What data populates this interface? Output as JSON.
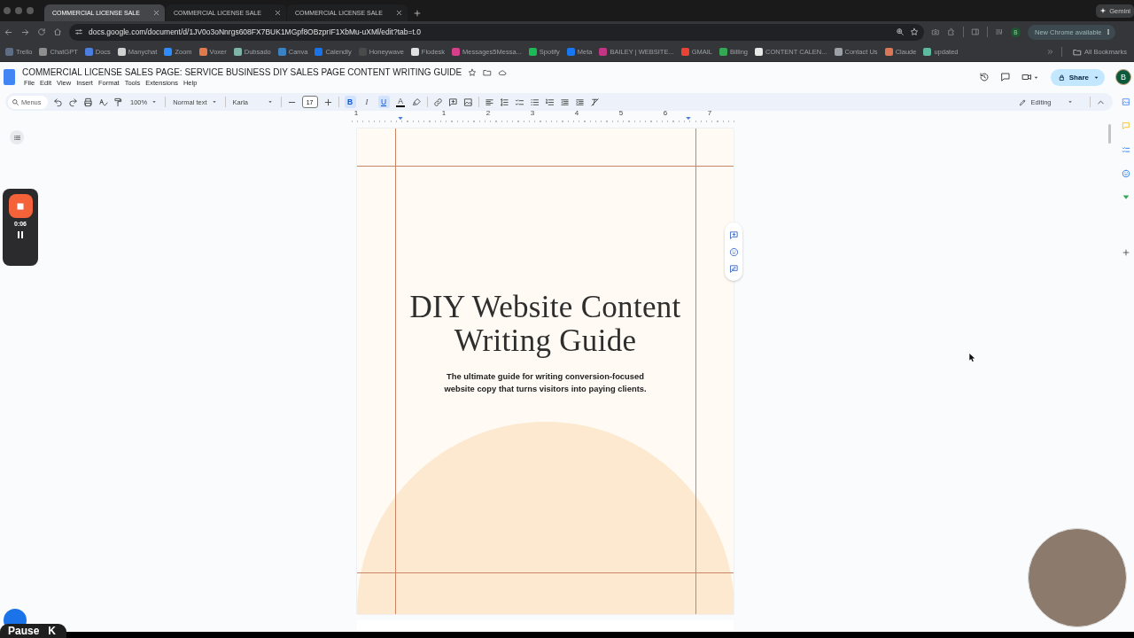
{
  "browser": {
    "tabs": [
      {
        "title": "COMMERCIAL LICENSE SALE",
        "selected": true
      },
      {
        "title": "COMMERCIAL LICENSE SALE",
        "selected": false
      },
      {
        "title": "COMMERCIAL LICENSE SALE",
        "selected": false
      }
    ],
    "gemini_button": "Gemini",
    "address": "docs.google.com/document/d/1JV0o3oNnrgs608FX7BUK1MGpf8OBzprIF1XbMu-uXMl/edit?tab=t.0",
    "profile_initial": "B",
    "update_button": "New Chrome available",
    "bookmarks": [
      {
        "label": "Trello",
        "color": "#5e6c84"
      },
      {
        "label": "ChatGPT",
        "color": "#8e8e8e"
      },
      {
        "label": "Docs",
        "color": "#4a7fe0"
      },
      {
        "label": "Manychat",
        "color": "#d0d0d0"
      },
      {
        "label": "Zoom",
        "color": "#2d8cff"
      },
      {
        "label": "Voxer",
        "color": "#e07a4a"
      },
      {
        "label": "Dubsado",
        "color": "#7fb5a8"
      },
      {
        "label": "Canva",
        "color": "#3b82c4"
      },
      {
        "label": "Calendly",
        "color": "#1a73e8"
      },
      {
        "label": "Honeywave",
        "color": "#4a4a4a"
      },
      {
        "label": "Flodesk",
        "color": "#e0e0e0"
      },
      {
        "label": "Messages5Messa...",
        "color": "#d6408a"
      },
      {
        "label": "Spotify",
        "color": "#1db954"
      },
      {
        "label": "Meta",
        "color": "#1877f2"
      },
      {
        "label": "BAILEY | WEBSITE...",
        "color": "#c13584"
      },
      {
        "label": "GMAIL",
        "color": "#ea4335"
      },
      {
        "label": "Billing",
        "color": "#34a853"
      },
      {
        "label": "CONTENT CALEN...",
        "color": "#e8e8e8"
      },
      {
        "label": "Contact Us",
        "color": "#9aa0a6"
      },
      {
        "label": "Claude",
        "color": "#d97757"
      },
      {
        "label": "updated",
        "color": "#5fb8a0"
      }
    ],
    "all_bookmarks": "All Bookmarks"
  },
  "document": {
    "title": "COMMERCIAL LICENSE SALES PAGE: SERVICE BUSINESS DIY SALES PAGE CONTENT WRITING GUIDE",
    "menus": [
      "File",
      "Edit",
      "View",
      "Insert",
      "Format",
      "Tools",
      "Extensions",
      "Help"
    ],
    "share_button": "Share",
    "account_initial": "B",
    "toolbar": {
      "search_placeholder": "Menus",
      "zoom": "100%",
      "style": "Normal text",
      "font": "Karla",
      "font_size": "17",
      "format_buttons": [
        {
          "label": "B",
          "kind": "bold",
          "on": true
        },
        {
          "label": "I",
          "kind": "italic",
          "on": false
        },
        {
          "label": "U",
          "kind": "underline",
          "on": true
        },
        {
          "label": "A",
          "kind": "text_color",
          "on": false
        }
      ],
      "mode": "Editing"
    },
    "ruler_numbers": [
      "1",
      "1",
      "2",
      "3",
      "4",
      "5",
      "6",
      "7"
    ],
    "page": {
      "heading": "DIY Website Content Writing Guide",
      "subheading": "The ultimate guide for writing conversion-focused website copy that turns visitors into paying clients."
    }
  },
  "recorder": {
    "time": "0:06"
  },
  "pause_tooltip": {
    "label": "Pause",
    "shortcut": "K"
  }
}
